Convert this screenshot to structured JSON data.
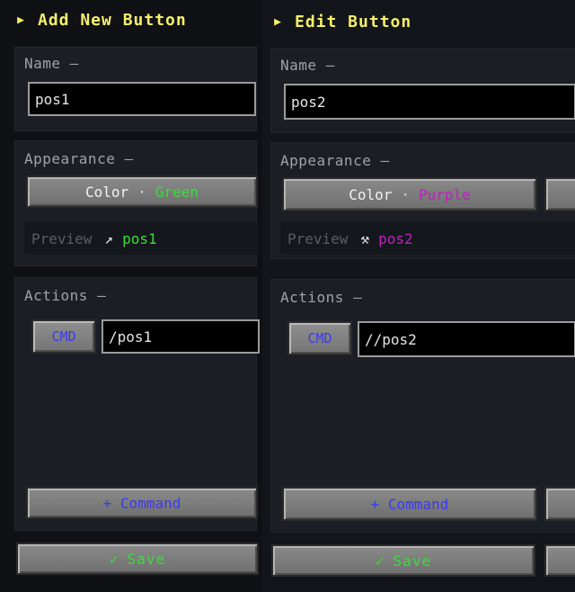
{
  "left_panel": {
    "title": "Add New Button",
    "title_icon": "play-arrow-icon",
    "name_section_label": "Name —",
    "name_value": "pos1",
    "appearance_section_label": "Appearance —",
    "color_label": "Color",
    "color_separator": "·",
    "color_value": "Green",
    "color_value_hex": "#3bdc3b",
    "preview_label": "Preview",
    "preview_icon": "↗",
    "preview_icon_name": "arrow-up-right-icon",
    "preview_text": "pos1",
    "actions_section_label": "Actions —",
    "cmd_label": "CMD",
    "cmd_value": "/pos1",
    "add_command_label": "+ Command",
    "save_check": "✓",
    "save_label": "Save"
  },
  "right_panel": {
    "title": "Edit Button",
    "title_icon": "play-arrow-icon",
    "name_section_label": "Name —",
    "name_value": "pos2",
    "appearance_section_label": "Appearance —",
    "color_label": "Color",
    "color_separator": "·",
    "color_value": "Purple",
    "color_value_hex": "#c020c0",
    "preview_label": "Preview",
    "preview_icon": "⚒",
    "preview_icon_name": "crossed-tools-icon",
    "preview_text": "pos2",
    "actions_section_label": "Actions —",
    "cmd_label": "CMD",
    "cmd_value": "//pos2",
    "add_command_label": "+ Command",
    "save_check": "✓",
    "save_label": "Save"
  },
  "colors": {
    "title_yellow": "#f6f06a",
    "section_label": "#9ea3ab",
    "cmd_blue": "#3a3af2",
    "save_green": "#3bdc3b"
  }
}
